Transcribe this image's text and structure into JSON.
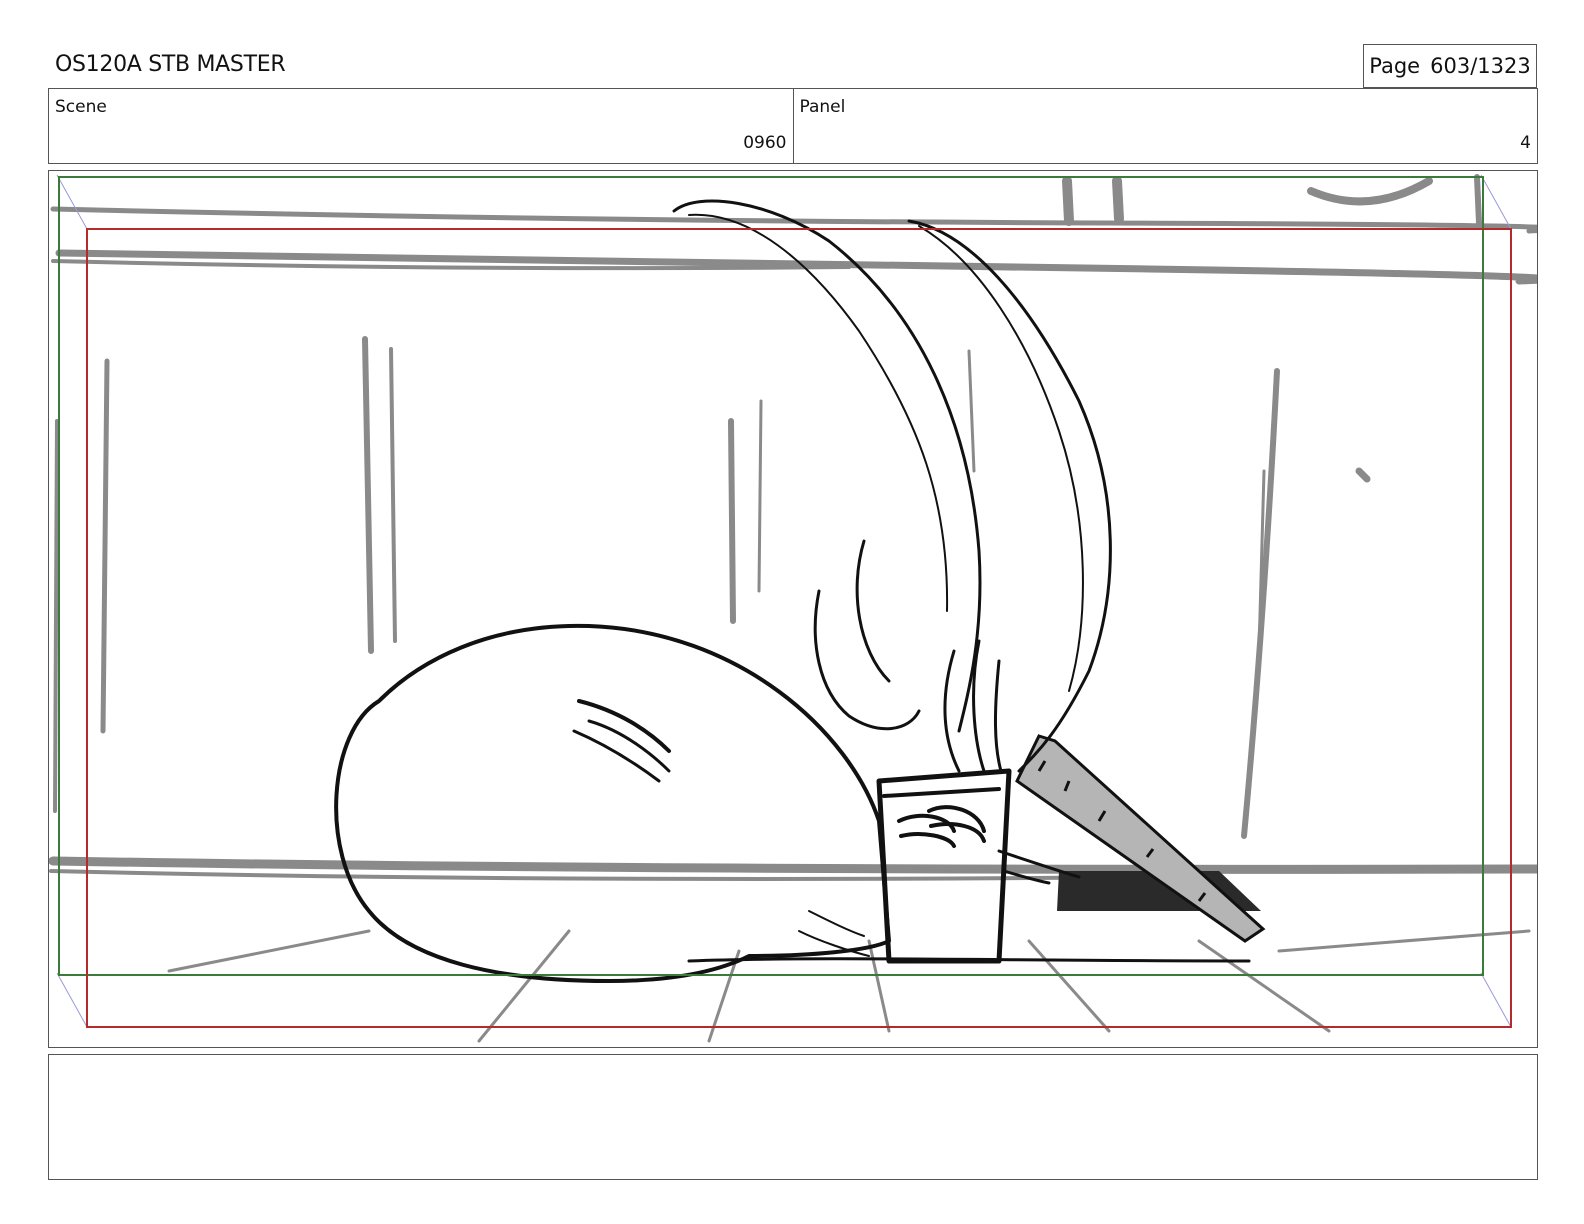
{
  "header": {
    "title": "OS120A STB MASTER",
    "page_label": "Page",
    "page_number": "603/1323"
  },
  "info": {
    "scene_label": "Scene",
    "scene_value": "0960",
    "panel_label": "Panel",
    "panel_value": "4"
  },
  "panel": {
    "safe_frame_color": "#3a7a3a",
    "action_frame_color": "#b52a2a",
    "shadow_color": "#2a2a2a",
    "tablet_color": "#b5b5b5"
  },
  "notes": {
    "text": ""
  }
}
